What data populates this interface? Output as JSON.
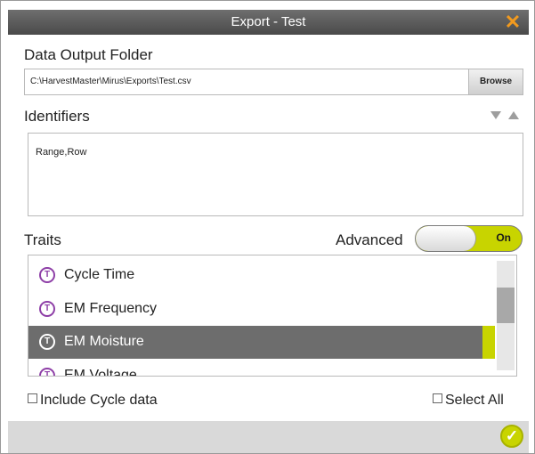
{
  "window": {
    "title": "Export - Test",
    "close_icon": "close-icon"
  },
  "output": {
    "label": "Data Output Folder",
    "path": "C:\\HarvestMaster\\Mirus\\Exports\\Test.csv",
    "browse_label": "Browse"
  },
  "identifiers": {
    "label": "Identifiers",
    "value": "Range,Row"
  },
  "traits": {
    "label": "Traits",
    "advanced_label": "Advanced",
    "toggle_text": "On",
    "items": [
      {
        "name": "Cycle Time",
        "icon": "trait-icon",
        "selected": false
      },
      {
        "name": "EM Frequency",
        "icon": "trait-icon",
        "selected": false
      },
      {
        "name": "EM Moisture",
        "icon": "trait-icon",
        "selected": true
      },
      {
        "name": "EM Voltage",
        "icon": "trait-icon",
        "selected": false
      }
    ]
  },
  "options": {
    "include_cycle": "Include Cycle data",
    "select_all": "Select All"
  },
  "colors": {
    "accent": "#c8d400",
    "close": "#f29a1e",
    "trait_icon": "#8e3fa7",
    "selected_row": "#6d6d6d"
  }
}
